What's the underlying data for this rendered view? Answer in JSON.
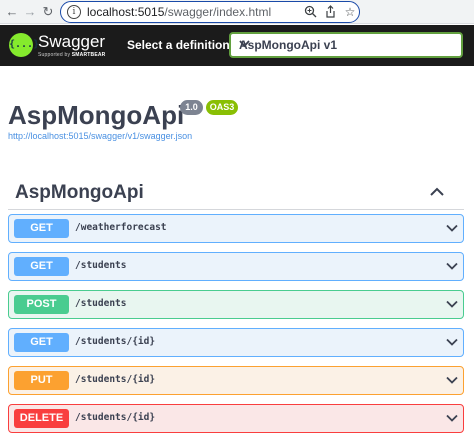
{
  "browser": {
    "url_host": "localhost:5015",
    "url_path": "/swagger/index.html",
    "back_icon": "arrow-left",
    "forward_icon": "arrow-right",
    "reload_icon": "reload"
  },
  "topbar": {
    "logo_text": "Swagger",
    "logo_sub_prefix": "Supported by ",
    "logo_sub_brand": "SMARTBEAR",
    "logo_glyph": "{...}",
    "definition_label": "Select a definition",
    "definition_value": "AspMongoApi v1"
  },
  "info": {
    "title": "AspMongoApi",
    "version": "1.0",
    "oas": "OAS3",
    "spec_url": "http://localhost:5015/swagger/v1/swagger.json"
  },
  "section": {
    "title": "AspMongoApi"
  },
  "operations": [
    {
      "method": "GET",
      "path": "/weatherforecast"
    },
    {
      "method": "GET",
      "path": "/students"
    },
    {
      "method": "POST",
      "path": "/students"
    },
    {
      "method": "GET",
      "path": "/students/{id}"
    },
    {
      "method": "PUT",
      "path": "/students/{id}"
    },
    {
      "method": "DELETE",
      "path": "/students/{id}"
    }
  ],
  "colors": {
    "get": "#61affe",
    "post": "#49cc90",
    "put": "#fca130",
    "delete": "#f93e3e",
    "topbar": "#1b1b1b",
    "logo": "#85ea2d"
  }
}
